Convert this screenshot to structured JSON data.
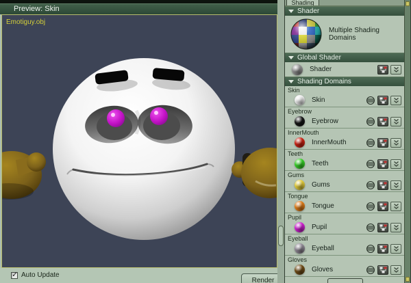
{
  "window": {
    "preview_title": "Preview: Skin"
  },
  "viewport": {
    "object_label": "Emotiguy.obj"
  },
  "footer": {
    "auto_update": "Auto Update",
    "auto_update_checked": "✓",
    "render": "Render"
  },
  "panel": {
    "tab": "Shading",
    "shader_section": {
      "header": "Shader",
      "caption": "Multiple Shading Domains"
    },
    "global_section": {
      "header": "Global Shader",
      "name": "Shader",
      "color": "#919191"
    },
    "domains_section": {
      "header": "Shading Domains"
    },
    "domains": [
      {
        "label": "Skin",
        "name": "Skin",
        "color": "#ececec"
      },
      {
        "label": "Eyebrow",
        "name": "Eyebrow",
        "color": "#161616"
      },
      {
        "label": "InnerMouth",
        "name": "InnerMouth",
        "color": "#c92112"
      },
      {
        "label": "Teeth",
        "name": "Teeth",
        "color": "#36cf26"
      },
      {
        "label": "Gums",
        "name": "Gums",
        "color": "#e2cc3a"
      },
      {
        "label": "Tongue",
        "name": "Tongue",
        "color": "#de7c19"
      },
      {
        "label": "Pupil",
        "name": "Pupil",
        "color": "#cd20d0"
      },
      {
        "label": "Eyeball",
        "name": "Eyeball",
        "color": "#8f8894"
      },
      {
        "label": "Gloves",
        "name": "Gloves",
        "color": "#6f4c17"
      }
    ]
  },
  "colors": {
    "header_green": "#3b5a45",
    "panel_bg": "#b5c5b4",
    "viewport_bg": "#3d4456",
    "viewport_border": "#b9bd6e",
    "object_label": "#d3cf3a",
    "scroll_marker": "#cbc766"
  }
}
